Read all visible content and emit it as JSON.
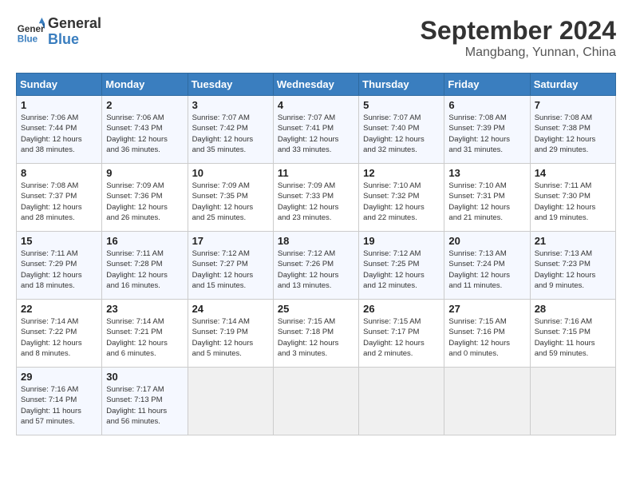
{
  "header": {
    "logo_line1": "General",
    "logo_line2": "Blue",
    "month": "September 2024",
    "location": "Mangbang, Yunnan, China"
  },
  "weekdays": [
    "Sunday",
    "Monday",
    "Tuesday",
    "Wednesday",
    "Thursday",
    "Friday",
    "Saturday"
  ],
  "weeks": [
    [
      {
        "day": "1",
        "info": "Sunrise: 7:06 AM\nSunset: 7:44 PM\nDaylight: 12 hours\nand 38 minutes."
      },
      {
        "day": "2",
        "info": "Sunrise: 7:06 AM\nSunset: 7:43 PM\nDaylight: 12 hours\nand 36 minutes."
      },
      {
        "day": "3",
        "info": "Sunrise: 7:07 AM\nSunset: 7:42 PM\nDaylight: 12 hours\nand 35 minutes."
      },
      {
        "day": "4",
        "info": "Sunrise: 7:07 AM\nSunset: 7:41 PM\nDaylight: 12 hours\nand 33 minutes."
      },
      {
        "day": "5",
        "info": "Sunrise: 7:07 AM\nSunset: 7:40 PM\nDaylight: 12 hours\nand 32 minutes."
      },
      {
        "day": "6",
        "info": "Sunrise: 7:08 AM\nSunset: 7:39 PM\nDaylight: 12 hours\nand 31 minutes."
      },
      {
        "day": "7",
        "info": "Sunrise: 7:08 AM\nSunset: 7:38 PM\nDaylight: 12 hours\nand 29 minutes."
      }
    ],
    [
      {
        "day": "8",
        "info": "Sunrise: 7:08 AM\nSunset: 7:37 PM\nDaylight: 12 hours\nand 28 minutes."
      },
      {
        "day": "9",
        "info": "Sunrise: 7:09 AM\nSunset: 7:36 PM\nDaylight: 12 hours\nand 26 minutes."
      },
      {
        "day": "10",
        "info": "Sunrise: 7:09 AM\nSunset: 7:35 PM\nDaylight: 12 hours\nand 25 minutes."
      },
      {
        "day": "11",
        "info": "Sunrise: 7:09 AM\nSunset: 7:33 PM\nDaylight: 12 hours\nand 23 minutes."
      },
      {
        "day": "12",
        "info": "Sunrise: 7:10 AM\nSunset: 7:32 PM\nDaylight: 12 hours\nand 22 minutes."
      },
      {
        "day": "13",
        "info": "Sunrise: 7:10 AM\nSunset: 7:31 PM\nDaylight: 12 hours\nand 21 minutes."
      },
      {
        "day": "14",
        "info": "Sunrise: 7:11 AM\nSunset: 7:30 PM\nDaylight: 12 hours\nand 19 minutes."
      }
    ],
    [
      {
        "day": "15",
        "info": "Sunrise: 7:11 AM\nSunset: 7:29 PM\nDaylight: 12 hours\nand 18 minutes."
      },
      {
        "day": "16",
        "info": "Sunrise: 7:11 AM\nSunset: 7:28 PM\nDaylight: 12 hours\nand 16 minutes."
      },
      {
        "day": "17",
        "info": "Sunrise: 7:12 AM\nSunset: 7:27 PM\nDaylight: 12 hours\nand 15 minutes."
      },
      {
        "day": "18",
        "info": "Sunrise: 7:12 AM\nSunset: 7:26 PM\nDaylight: 12 hours\nand 13 minutes."
      },
      {
        "day": "19",
        "info": "Sunrise: 7:12 AM\nSunset: 7:25 PM\nDaylight: 12 hours\nand 12 minutes."
      },
      {
        "day": "20",
        "info": "Sunrise: 7:13 AM\nSunset: 7:24 PM\nDaylight: 12 hours\nand 11 minutes."
      },
      {
        "day": "21",
        "info": "Sunrise: 7:13 AM\nSunset: 7:23 PM\nDaylight: 12 hours\nand 9 minutes."
      }
    ],
    [
      {
        "day": "22",
        "info": "Sunrise: 7:14 AM\nSunset: 7:22 PM\nDaylight: 12 hours\nand 8 minutes."
      },
      {
        "day": "23",
        "info": "Sunrise: 7:14 AM\nSunset: 7:21 PM\nDaylight: 12 hours\nand 6 minutes."
      },
      {
        "day": "24",
        "info": "Sunrise: 7:14 AM\nSunset: 7:19 PM\nDaylight: 12 hours\nand 5 minutes."
      },
      {
        "day": "25",
        "info": "Sunrise: 7:15 AM\nSunset: 7:18 PM\nDaylight: 12 hours\nand 3 minutes."
      },
      {
        "day": "26",
        "info": "Sunrise: 7:15 AM\nSunset: 7:17 PM\nDaylight: 12 hours\nand 2 minutes."
      },
      {
        "day": "27",
        "info": "Sunrise: 7:15 AM\nSunset: 7:16 PM\nDaylight: 12 hours\nand 0 minutes."
      },
      {
        "day": "28",
        "info": "Sunrise: 7:16 AM\nSunset: 7:15 PM\nDaylight: 11 hours\nand 59 minutes."
      }
    ],
    [
      {
        "day": "29",
        "info": "Sunrise: 7:16 AM\nSunset: 7:14 PM\nDaylight: 11 hours\nand 57 minutes."
      },
      {
        "day": "30",
        "info": "Sunrise: 7:17 AM\nSunset: 7:13 PM\nDaylight: 11 hours\nand 56 minutes."
      },
      {
        "day": "",
        "info": ""
      },
      {
        "day": "",
        "info": ""
      },
      {
        "day": "",
        "info": ""
      },
      {
        "day": "",
        "info": ""
      },
      {
        "day": "",
        "info": ""
      }
    ]
  ]
}
